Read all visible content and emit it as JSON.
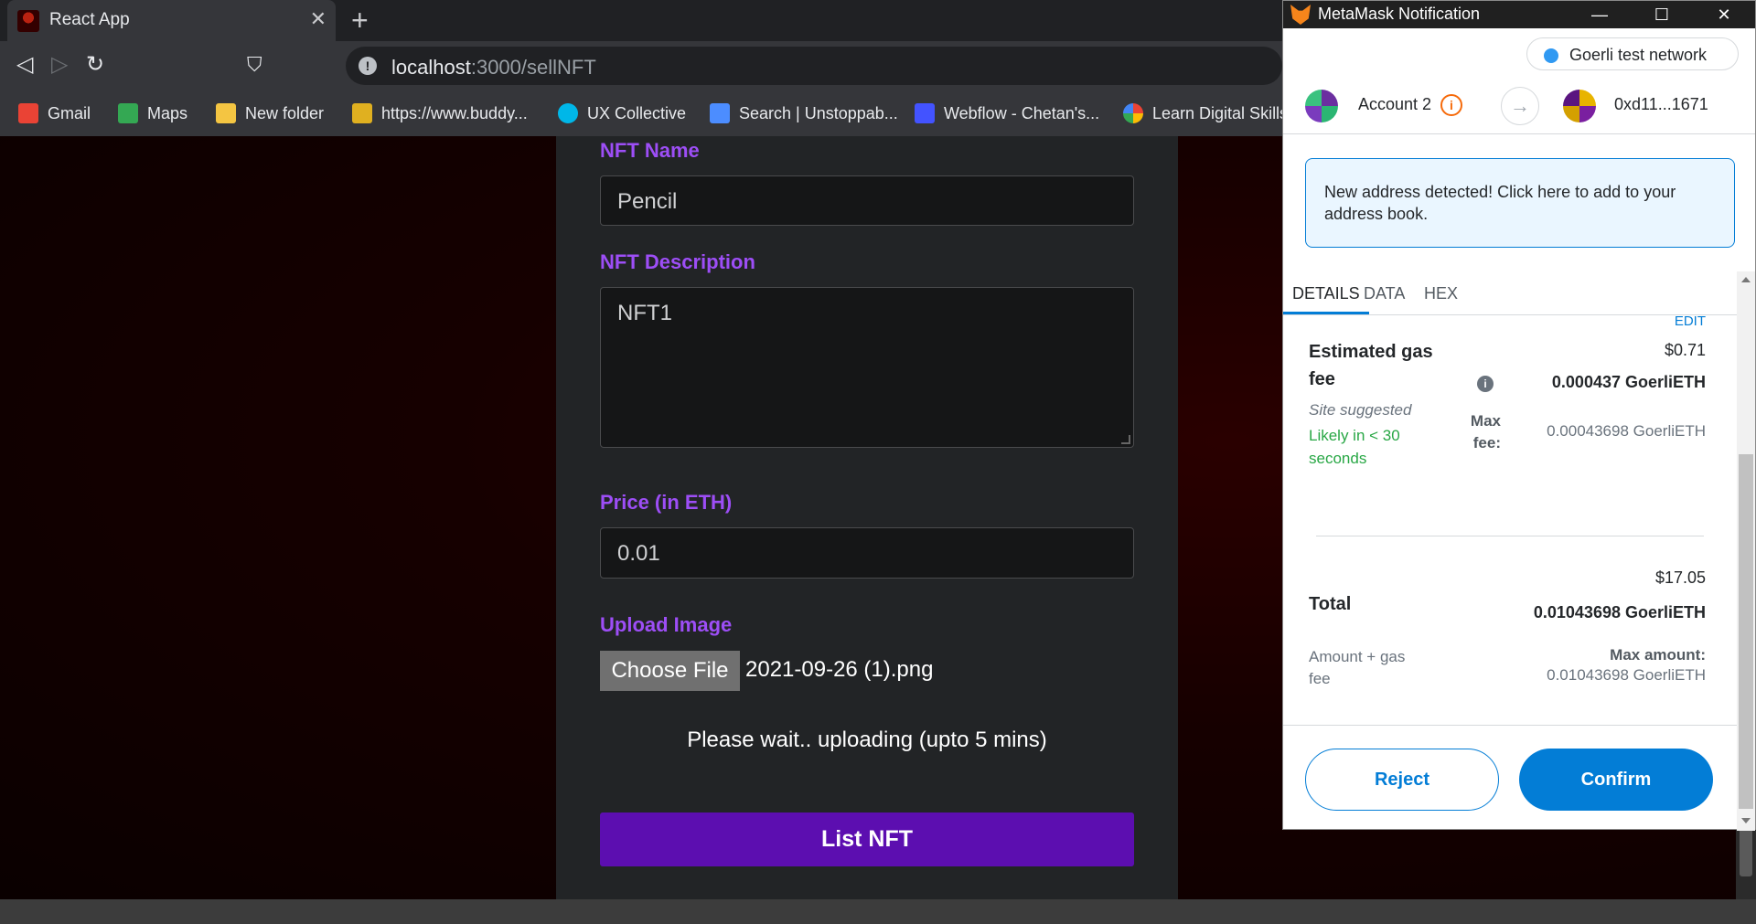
{
  "browser": {
    "tab_title": "React App",
    "tab_close": "✕",
    "new_tab": "+",
    "url_host": "localhost",
    "url_path": ":3000/sellNFT",
    "bookmarks": [
      {
        "label": "Gmail",
        "icon": "gmail-icon",
        "color": "#ea4335"
      },
      {
        "label": "Maps",
        "icon": "maps-icon",
        "color": "#34a853"
      },
      {
        "label": "New folder",
        "icon": "folder-icon",
        "color": "#f4c542"
      },
      {
        "label": "https://www.buddy...",
        "icon": "buddy-icon",
        "color": "#e0b020"
      },
      {
        "label": "UX Collective",
        "icon": "ux-collective-icon",
        "color": "#00b7e8"
      },
      {
        "label": "Search | Unstoppab...",
        "icon": "unstoppable-icon",
        "color": "#4c8dff"
      },
      {
        "label": "Webflow - Chetan's...",
        "icon": "webflow-icon",
        "color": "#4353ff"
      },
      {
        "label": "Learn Digital Skills",
        "icon": "google-icon",
        "color": "#4285f4"
      }
    ]
  },
  "form": {
    "name_label": "NFT Name",
    "name_value": "Pencil",
    "description_label": "NFT Description",
    "description_value": "NFT1",
    "price_label": "Price (in ETH)",
    "price_value": "0.01",
    "upload_label": "Upload Image",
    "choose_file_label": "Choose File",
    "file_name": "2021-09-26 (1).png",
    "wait_message": "Please wait.. uploading (upto 5 mins)",
    "submit_label": "List NFT"
  },
  "metamask": {
    "window_title": "MetaMask Notification",
    "network": "Goerli test network",
    "from_account": "Account 2",
    "to_address": "0xd11...1671",
    "notice": "New address detected! Click here to add to your address book.",
    "tabs": [
      "DETAILS",
      "DATA",
      "HEX"
    ],
    "edit_label": "EDIT",
    "gas_label_line1": "Estimated gas",
    "gas_label_line2": "fee",
    "gas_usd": "$0.71",
    "gas_eth": "0.000437 GoerliETH",
    "site_suggested": "Site suggested",
    "likely_line1": "Likely in < 30",
    "likely_line2": "seconds",
    "max_fee_label_line1": "Max",
    "max_fee_label_line2": "fee:",
    "max_fee_value": "0.00043698 GoerliETH",
    "total_label": "Total",
    "total_usd": "$17.05",
    "total_eth": "0.01043698 GoerliETH",
    "amount_gas_line1": "Amount + gas",
    "amount_gas_line2": "fee",
    "max_amount_label": "Max amount:",
    "max_amount_value": "0.01043698 GoerliETH",
    "reject_label": "Reject",
    "confirm_label": "Confirm"
  },
  "colors": {
    "accent_purple": "#9d4ef6",
    "list_button": "#5c0eb0",
    "metamask_blue": "#037dd6",
    "success_green": "#28a745"
  }
}
